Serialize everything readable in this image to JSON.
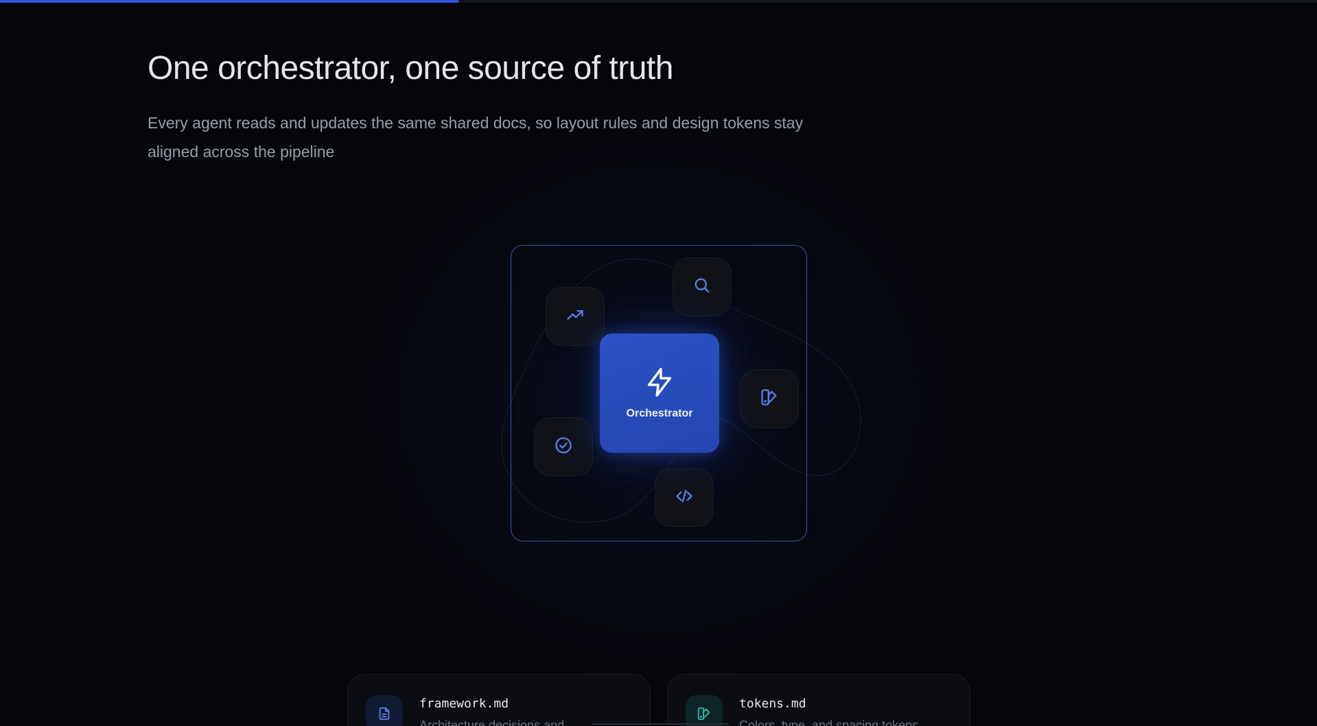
{
  "progress": {
    "percent": 34.8
  },
  "header": {
    "title": "One orchestrator, one source of truth",
    "subtitle": "Every agent reads and updates the same shared docs, so layout rules and design tokens stay aligned across the pipeline"
  },
  "diagram": {
    "core_label": "Orchestrator",
    "agents": [
      {
        "icon": "trending-up-icon"
      },
      {
        "icon": "search-icon"
      },
      {
        "icon": "palette-icon"
      },
      {
        "icon": "check-circle-icon"
      },
      {
        "icon": "code-icon"
      }
    ],
    "accent": "#2f56d6",
    "icon_color": "#5b7ee8"
  },
  "cards": [
    {
      "title": "framework.md",
      "description": "Architecture decisions and",
      "icon": "file-text-icon",
      "icon_color": "#5b7ee8"
    },
    {
      "title": "tokens.md",
      "description": "Colors, type, and spacing tokens",
      "icon": "palette-icon",
      "icon_color": "#2fc3a8"
    }
  ]
}
